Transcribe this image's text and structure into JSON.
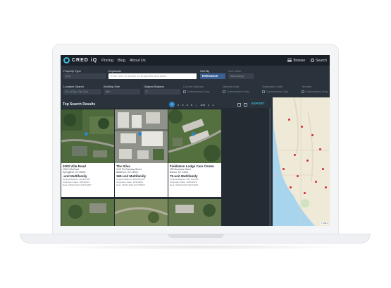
{
  "nav": {
    "logo": "CRED iQ",
    "links": [
      "Pricing",
      "Blog",
      "About Us"
    ],
    "browse": "Browse",
    "search": "Search"
  },
  "filters": {
    "property_type_label": "Property Type",
    "property_type_value": "Any",
    "keywords_label": "Keywords",
    "keywords_placeholder": "Enter here to search for properties and loans",
    "sort_by_label": "Sort By",
    "sort_by_value": "Relevance",
    "sort_order_label": "Sort Order",
    "sort_order_value": "Ascending",
    "location_label": "Location Search",
    "location_placeholder": "Ex. (City, Cty, Cou",
    "building_size_label": "Building Size",
    "building_size_placeholder": "Min",
    "original_balance_label": "Original Balance",
    "original_balance_placeholder": "$",
    "current_balance_label": "Current Balance",
    "current_balance_option": "Subscription Only",
    "maturity_date_label": "Maturity Date",
    "maturity_date_option": "Subscription Only",
    "origination_date_label": "Origination Date",
    "origination_date_option": "Subscription Only",
    "tenants_label": "Tenants",
    "tenants_option": "Subscription Only"
  },
  "results": {
    "title": "Top Search Results",
    "pages": [
      "1",
      "2",
      "3",
      "4",
      "5",
      "...",
      "100",
      "1",
      "1"
    ],
    "export": "EXPORT"
  },
  "cards": [
    {
      "title": "2000 Villa Road",
      "addr1": "2000 Villa Road",
      "addr2": "Springfield, OH 45503",
      "type": "-unit Multifamily",
      "meta1": "Original Balance: $4,985,000",
      "meta2": "Origination Date: 10/26/2021",
      "meta3": "Deal: GNMA 2021-341TF4287"
    },
    {
      "title": "The Silva",
      "addr1": "1115 Pin Parkway Street",
      "addr2": "Baltimore, OH 41009",
      "type": "169-unit Multifamily",
      "meta1": "Original Balance: $19,999,500",
      "meta2": "Origination Date: 10/26/2021",
      "meta3": "Deal: GNMA 2022-341TF5028"
    },
    {
      "title": "Fieldstern Lodge Care Center",
      "addr1": "999 Meadows Street",
      "addr2": "Bianco, NY 13621",
      "type": "75-unit Multifamily",
      "meta1": "Original Balance: $23,700,000",
      "meta2": "Origination Date: 10/26/2021",
      "meta3": "Deal: GNMA 2022-341TF4261"
    }
  ],
  "map": {
    "attribution": "© 2024"
  }
}
